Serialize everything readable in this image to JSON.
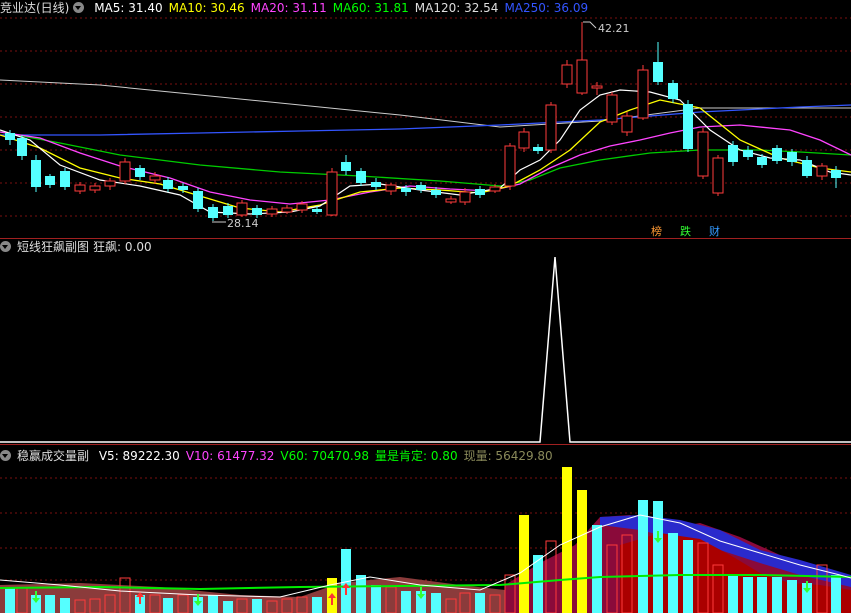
{
  "main": {
    "title": "竞业达(日线)",
    "ma": [
      {
        "label": "MA5: 31.40",
        "color": "#ffffff"
      },
      {
        "label": "MA10: 30.46",
        "color": "#ffff00"
      },
      {
        "label": "MA20: 31.11",
        "color": "#ff44ff"
      },
      {
        "label": "MA60: 31.81",
        "color": "#00ff00"
      },
      {
        "label": "MA120: 32.54",
        "color": "#dddddd"
      },
      {
        "label": "MA250: 36.09",
        "color": "#3355ff"
      }
    ],
    "high_label": "42.21",
    "low_label": "28.14",
    "tags": [
      "榜",
      "跌",
      "财"
    ]
  },
  "sub1": {
    "title": "短线狂飙副图",
    "value_label": "狂飙: 0.00"
  },
  "sub2": {
    "title": "稳赢成交量副",
    "items": [
      {
        "label": "V5: 89222.30",
        "color": "#ffffff"
      },
      {
        "label": "V10: 61477.32",
        "color": "#ff44ff"
      },
      {
        "label": "V60: 70470.98",
        "color": "#00ff00"
      },
      {
        "label": "量是肯定: 0.80",
        "color": "#00ff00"
      },
      {
        "label": "现量: 56429.80",
        "color": "#8a8a5a"
      }
    ]
  },
  "colors": {
    "up": "#ff3b3b",
    "down": "#55ffff",
    "grid": "#7a1010"
  }
}
